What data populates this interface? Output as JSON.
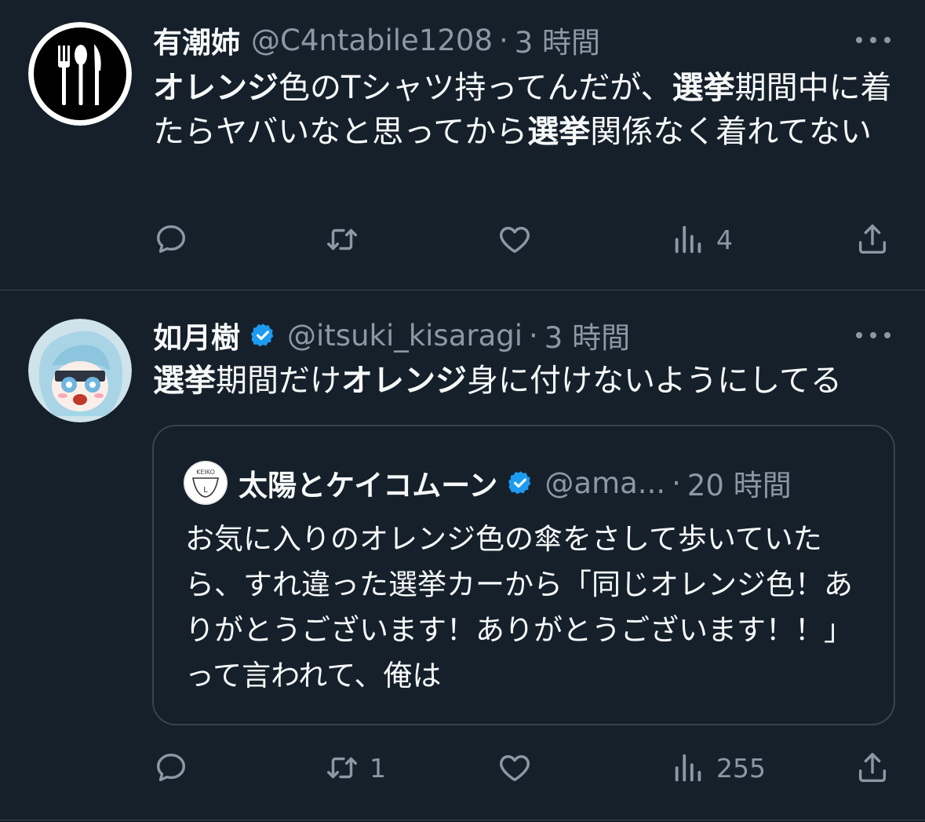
{
  "tweets": [
    {
      "name": "有潮姉",
      "handle": "@C4ntabile1208",
      "dot": "·",
      "time": "3 時間",
      "segments": [
        {
          "text": "オレンジ",
          "bold": true
        },
        {
          "text": "色のTシャツ持ってんだが、",
          "bold": false
        },
        {
          "text": "選挙",
          "bold": true
        },
        {
          "text": "期間中に着たらヤバいなと思ってから",
          "bold": false
        },
        {
          "text": "選挙",
          "bold": true
        },
        {
          "text": "関係なく着れてない",
          "bold": false
        }
      ],
      "actions": {
        "reply": "",
        "retweet": "",
        "like": "",
        "views": "4"
      }
    },
    {
      "name": "如月樹",
      "handle": "@itsuki_kisaragi",
      "dot": "·",
      "time": "3 時間",
      "verified": true,
      "segments": [
        {
          "text": "選挙",
          "bold": true
        },
        {
          "text": "期間だけ",
          "bold": false
        },
        {
          "text": "オレンジ",
          "bold": true
        },
        {
          "text": "身に付けないようにしてる",
          "bold": false
        }
      ],
      "quote": {
        "name": "太陽とケイコムーン",
        "handle": "@ama...",
        "dot": "·",
        "time": "20 時間",
        "avatar_text": "KEIKO",
        "avatar_letter": "L",
        "text": "お気に入りのオレンジ色の傘をさして歩いていたら、すれ違った選挙カーから「同じオレンジ色！ありがとうございます！ありがとうございます！！」って言われて、俺は"
      },
      "actions": {
        "reply": "",
        "retweet": "1",
        "like": "",
        "views": "255"
      }
    }
  ],
  "colors": {
    "background": "#15202b",
    "muted": "#8b98a5",
    "divider": "#38444d",
    "verified": "#1d9bf0"
  }
}
